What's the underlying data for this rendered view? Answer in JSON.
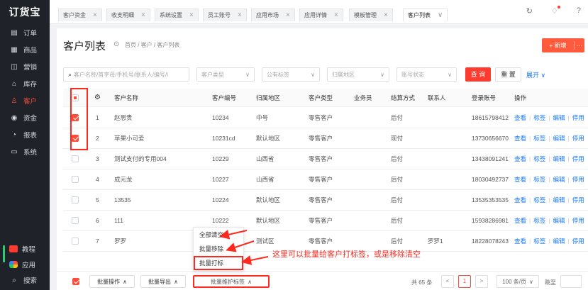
{
  "app": {
    "logo": "订货宝"
  },
  "sidebar": {
    "items": [
      {
        "label": "订单",
        "icon": "order-icon",
        "glyph": "▤"
      },
      {
        "label": "商品",
        "icon": "goods-icon",
        "glyph": "▦"
      },
      {
        "label": "营销",
        "icon": "marketing-icon",
        "glyph": "◫"
      },
      {
        "label": "库存",
        "icon": "warehouse-icon",
        "glyph": "⌂"
      },
      {
        "label": "客户",
        "icon": "customer-icon",
        "glyph": "♙",
        "active": true
      },
      {
        "label": "资金",
        "icon": "money-icon",
        "glyph": "◉"
      },
      {
        "label": "报表",
        "icon": "report-icon",
        "glyph": "◔"
      },
      {
        "label": "系统",
        "icon": "monitor-icon",
        "glyph": "▭"
      }
    ],
    "bottom": [
      {
        "label": "教程",
        "icon": "tutorial-icon"
      },
      {
        "label": "应用",
        "icon": "apps-icon"
      },
      {
        "label": "搜索",
        "icon": "search-icon",
        "glyph": "⌕"
      }
    ]
  },
  "tabs": [
    {
      "label": "客户资金"
    },
    {
      "label": "收支明细"
    },
    {
      "label": "系统设置"
    },
    {
      "label": "员工账号"
    },
    {
      "label": "应用市场"
    },
    {
      "label": "应用详情"
    },
    {
      "label": "模板管理"
    },
    {
      "label": "客户列表",
      "active": true
    }
  ],
  "header": {
    "title": "客户列表",
    "breadcrumb": "首页 / 客户 / 客户列表",
    "new_label": "+ 新增",
    "more": "···"
  },
  "filters": {
    "search_placeholder": "客户名称/首字母/手机号/联系人/编号/l",
    "customer_type": "客户类型",
    "tag": "公有标签",
    "region": "归属地区",
    "account_status": "账号状态",
    "query": "查 询",
    "reset": "重 置",
    "expand": "展开 ∨"
  },
  "table": {
    "columns": [
      "客户名称",
      "客户编号",
      "归属地区",
      "客户类型",
      "业务员",
      "结算方式",
      "联系人",
      "登录账号",
      "操作"
    ],
    "ops": [
      "查看",
      "标签",
      "编辑",
      "停用"
    ],
    "rows": [
      {
        "idx": "1",
        "name": "赵思贵",
        "code": "10234",
        "region": "中号",
        "type": "零售客户",
        "staff": "",
        "pay": "后付",
        "contact": "",
        "login": "18615798412",
        "checked": true
      },
      {
        "idx": "2",
        "name": "苹果小可爱",
        "code": "10231cd",
        "region": "默认地区",
        "type": "零售客户",
        "staff": "",
        "pay": "现付",
        "contact": "",
        "login": "13730656670",
        "checked": true
      },
      {
        "idx": "3",
        "name": "测试支付的专用004",
        "code": "10229",
        "region": "山西省",
        "type": "零售客户",
        "staff": "",
        "pay": "后付",
        "contact": "",
        "login": "13438091241",
        "checked": false
      },
      {
        "idx": "4",
        "name": "成元龙",
        "code": "10227",
        "region": "山西省",
        "type": "零售客户",
        "staff": "",
        "pay": "后付",
        "contact": "",
        "login": "18030492737",
        "checked": false
      },
      {
        "idx": "5",
        "name": "13535",
        "code": "10224",
        "region": "默认地区",
        "type": "零售客户",
        "staff": "",
        "pay": "后付",
        "contact": "",
        "login": "13535353535",
        "checked": false
      },
      {
        "idx": "6",
        "name": "111",
        "code": "10222",
        "region": "默认地区",
        "type": "零售客户",
        "staff": "",
        "pay": "后付",
        "contact": "",
        "login": "15938286981",
        "checked": false
      },
      {
        "idx": "7",
        "name": "罗罗",
        "code": "",
        "region": "测试区",
        "type": "零售客户",
        "staff": "",
        "pay": "后付",
        "contact": "罗罗1",
        "login": "18228078243",
        "checked": false
      }
    ]
  },
  "popup": {
    "items": [
      "全部清空",
      "批量移除",
      "批量打标"
    ]
  },
  "annotation": "这里可以批量给客户打标签，或是移除清空",
  "bottom": {
    "batch_ops": "批量操作",
    "batch_export": "批量导出",
    "batch_tags": "批量维护标签",
    "total": "共 65 条",
    "page": "1",
    "page_size": "100 条/页",
    "jump": "跳至"
  },
  "colors": {
    "accent": "#ff4d3a",
    "link": "#1677ff",
    "annotation": "#ff2a1f"
  }
}
